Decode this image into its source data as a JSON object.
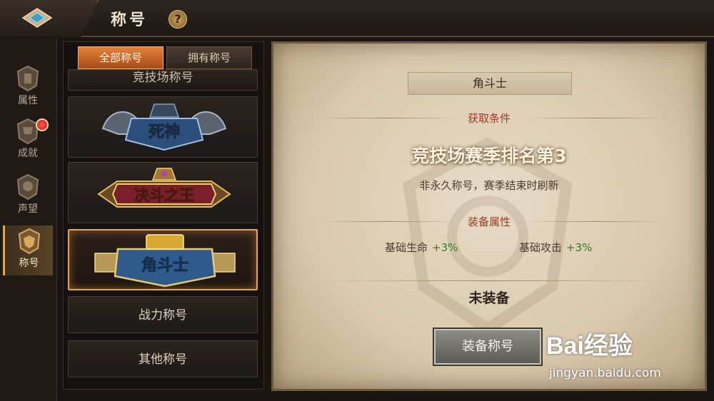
{
  "header": {
    "title": "称号",
    "help": "?"
  },
  "sidebar": {
    "items": [
      {
        "label": "属性",
        "icon": "attribute-emblem-icon",
        "badge": false,
        "active": false
      },
      {
        "label": "成就",
        "icon": "achievement-emblem-icon",
        "badge": true,
        "active": false
      },
      {
        "label": "声望",
        "icon": "reputation-emblem-icon",
        "badge": false,
        "active": false
      },
      {
        "label": "称号",
        "icon": "title-emblem-icon",
        "badge": false,
        "active": true
      }
    ]
  },
  "list": {
    "tabs": [
      {
        "label": "全部称号",
        "active": true
      },
      {
        "label": "拥有称号",
        "active": false
      }
    ],
    "cut_row_label": "竞技场称号",
    "badges": [
      {
        "text": "死神",
        "selected": false
      },
      {
        "text": "决斗之王",
        "selected": false
      },
      {
        "text": "角斗士",
        "selected": true
      }
    ],
    "rows": [
      {
        "label": "战力称号"
      },
      {
        "label": "其他称号"
      }
    ]
  },
  "detail": {
    "name": "角斗士",
    "condition_title": "获取条件",
    "condition": "竞技场赛季排名第3",
    "condition_desc": "非永久称号，赛季结束时刷新",
    "attr_title": "装备属性",
    "attrs": [
      {
        "name": "基础生命",
        "value": "+3%"
      },
      {
        "name": "基础攻击",
        "value": "+3%"
      }
    ],
    "status": "未装备",
    "equip_button": "装备称号"
  },
  "watermark": {
    "logo": "Bai经验",
    "url": "jingyan.baidu.com"
  },
  "colors": {
    "accent": "#e3823a",
    "positive": "#2f7c2a",
    "section": "#a03a24"
  }
}
